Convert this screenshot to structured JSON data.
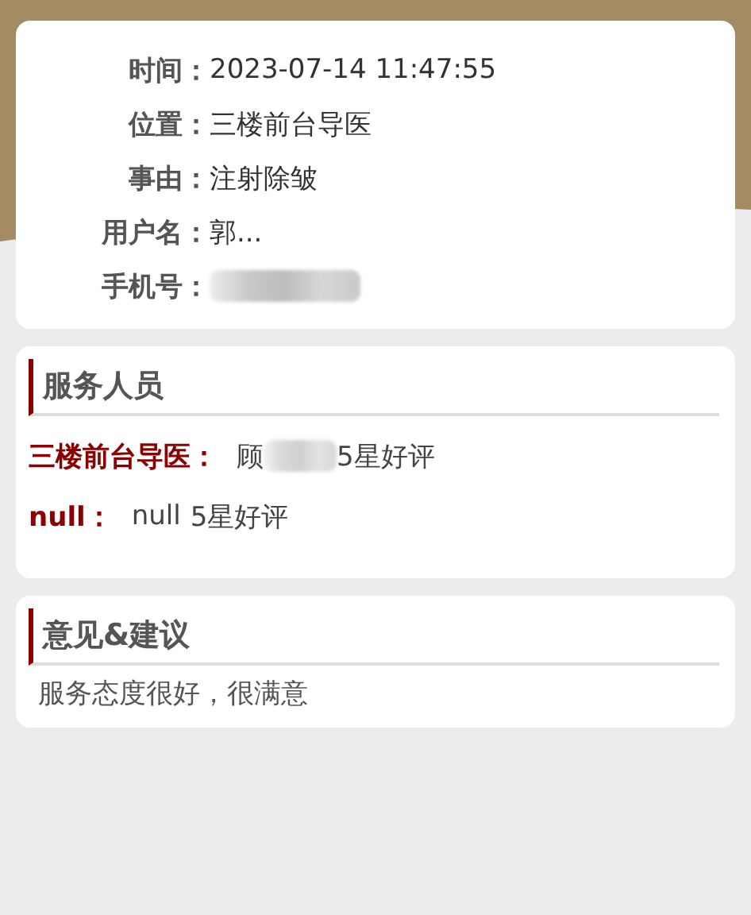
{
  "info": [
    {
      "label": "时间：",
      "value": "2023-07-14 11:47:55",
      "redacted": false
    },
    {
      "label": "位置：",
      "value": "三楼前台导医",
      "redacted": false
    },
    {
      "label": "事由：",
      "value": "注射除皱",
      "redacted": false
    },
    {
      "label": "用户名：",
      "value": "郭...",
      "redacted": false
    },
    {
      "label": "手机号：",
      "redacted": true
    }
  ],
  "staff": {
    "title": "服务人员",
    "items": [
      {
        "role": "三楼前台导医：",
        "name": "顾",
        "redacted": true,
        "rating": "5星好评"
      },
      {
        "role": "null：",
        "name": "null",
        "redacted": false,
        "rating": "5星好评"
      }
    ]
  },
  "feedback": {
    "title": "意见&建议",
    "text": "服务态度很好，很满意"
  }
}
